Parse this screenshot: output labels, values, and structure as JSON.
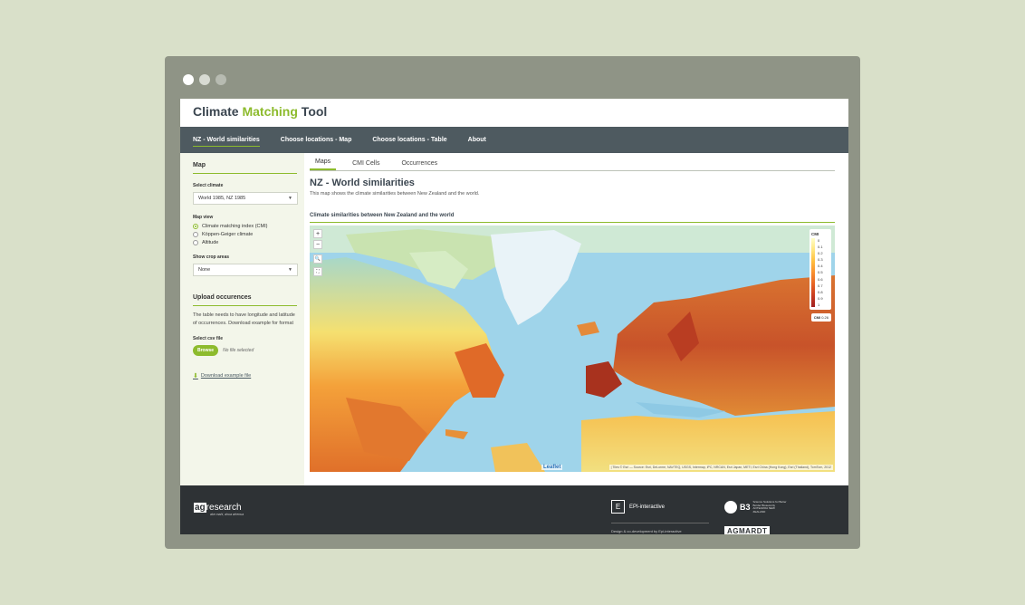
{
  "app": {
    "title_part1": "Climate ",
    "title_accent": "Matching",
    "title_part2": " Tool",
    "accent_color": "#8dbb2d",
    "nav_color": "#4e5a60"
  },
  "nav": {
    "tabs": [
      {
        "label": "NZ - World similarities",
        "active": true
      },
      {
        "label": "Choose locations - Map"
      },
      {
        "label": "Choose locations - Table"
      },
      {
        "label": "About"
      }
    ]
  },
  "sidebar": {
    "map_heading": "Map",
    "select_climate_label": "Select climate",
    "select_climate_value": "World 1985, NZ 1985",
    "map_view_label": "Map view",
    "map_view_options": [
      {
        "label": "Climate matching index (CMI)",
        "checked": true
      },
      {
        "label": "Köppen-Geiger climate"
      },
      {
        "label": "Altitude"
      }
    ],
    "crop_label": "Show crop areas",
    "crop_value": "None",
    "upload_heading": "Upload occurences",
    "upload_text": "The table needs to have longitude and latitude of occurrences. Download example for format",
    "csv_label": "Select csv file",
    "browse_label": "Browse",
    "no_file": "No file selected",
    "download_label": "Download example file"
  },
  "main": {
    "tabs": [
      {
        "label": "Maps",
        "active": true
      },
      {
        "label": "CMI Cells"
      },
      {
        "label": "Occurrences"
      }
    ],
    "title": "NZ - World similarities",
    "description": "This map shows the climate similarities between New Zealand and the world.",
    "map_caption": "Climate similarities between New Zealand and the world"
  },
  "map": {
    "zoom_in": "+",
    "zoom_out": "−",
    "search_icon": "🔍",
    "fullscreen_icon": "⛶",
    "legend_title": "CMI",
    "legend_ticks": [
      "0",
      "0.1",
      "0.2",
      "0.3",
      "0.4",
      "0.5",
      "0.6",
      "0.7",
      "0.8",
      "0.9",
      "1"
    ],
    "legend_value_label": "CMI",
    "legend_value": "0.26",
    "leaflet": "Leaflet",
    "attribution": "| Tiles © Esri — Source: Esri, DeLorme, NAVTEQ, USGS, Intermap, iPC, NRCAN, Esri Japan, METI, Esri China (Hong Kong), Esri (Thailand), TomTom, 2012"
  },
  "footer": {
    "ag_box": "ag",
    "ag_rest": "research",
    "ag_tagline": "ake mahi, ahua whenua",
    "epi_letter": "E",
    "epi_name": "EPI-interactive",
    "epi_credit": "Design & co-development by Epi-interactive",
    "b3_mark": "B3",
    "b3_text": "Science Solutions for Better Border Biosecurity AOTEAROA NEW ZEALAND",
    "agmardt": "AGMARDT"
  }
}
